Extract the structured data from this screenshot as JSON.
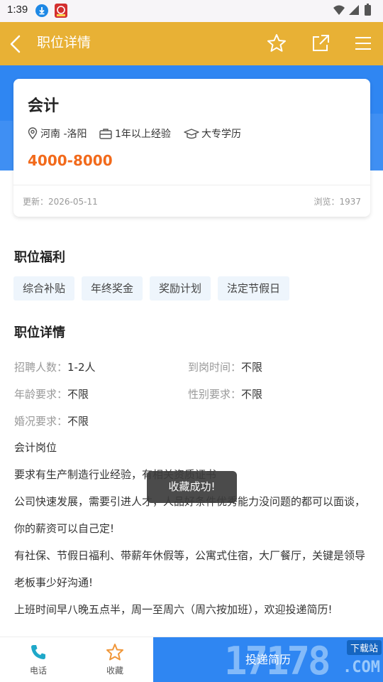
{
  "status_bar": {
    "time": "1:39"
  },
  "app_bar": {
    "title": "职位详情"
  },
  "job": {
    "title": "会计",
    "location": "河南 -洛阳",
    "experience": "1年以上经验",
    "education": "大专学历",
    "salary": "4000-8000",
    "updated": "更新：2026-05-11",
    "views": "浏览：1937"
  },
  "benefits": {
    "title": "职位福利",
    "tags": [
      "综合补贴",
      "年终奖金",
      "奖励计划",
      "法定节假日"
    ]
  },
  "details": {
    "title": "职位详情",
    "fields": [
      {
        "key": "招聘人数：",
        "value": "1-2人"
      },
      {
        "key": "到岗时间：",
        "value": "不限"
      },
      {
        "key": "年龄要求：",
        "value": "不限"
      },
      {
        "key": "性别要求：",
        "value": "不限"
      },
      {
        "key": "婚况要求：",
        "value": "不限"
      }
    ],
    "description": [
      "会计岗位",
      "要求有生产制造行业经验，有相关资质证书",
      "公司快速发展，需要引进人才，人品好条件优秀能力没问题的都可以面谈，",
      "你的薪资可以自己定!",
      "有社保、节假日福利、带薪年休假等，公寓式住宿，大厂餐厅，关键是领导",
      "老板事少好沟通!",
      "上班时间早八晚五点半，周一至周六（周六按加班），欢迎投递简历!"
    ]
  },
  "toast": "收藏成功!",
  "bottom_bar": {
    "phone_label": "电话",
    "favorite_label": "收藏",
    "apply_label": "投递简历"
  },
  "watermark": {
    "number": "17178",
    "site": "下载站",
    "domain": ".COM"
  },
  "colors": {
    "app_bar": "#e8b135",
    "blue_band": "#2f86f2",
    "salary": "#f26a1b",
    "phone_icon": "#1fa8c9",
    "favorite_icon": "#f0973a"
  }
}
